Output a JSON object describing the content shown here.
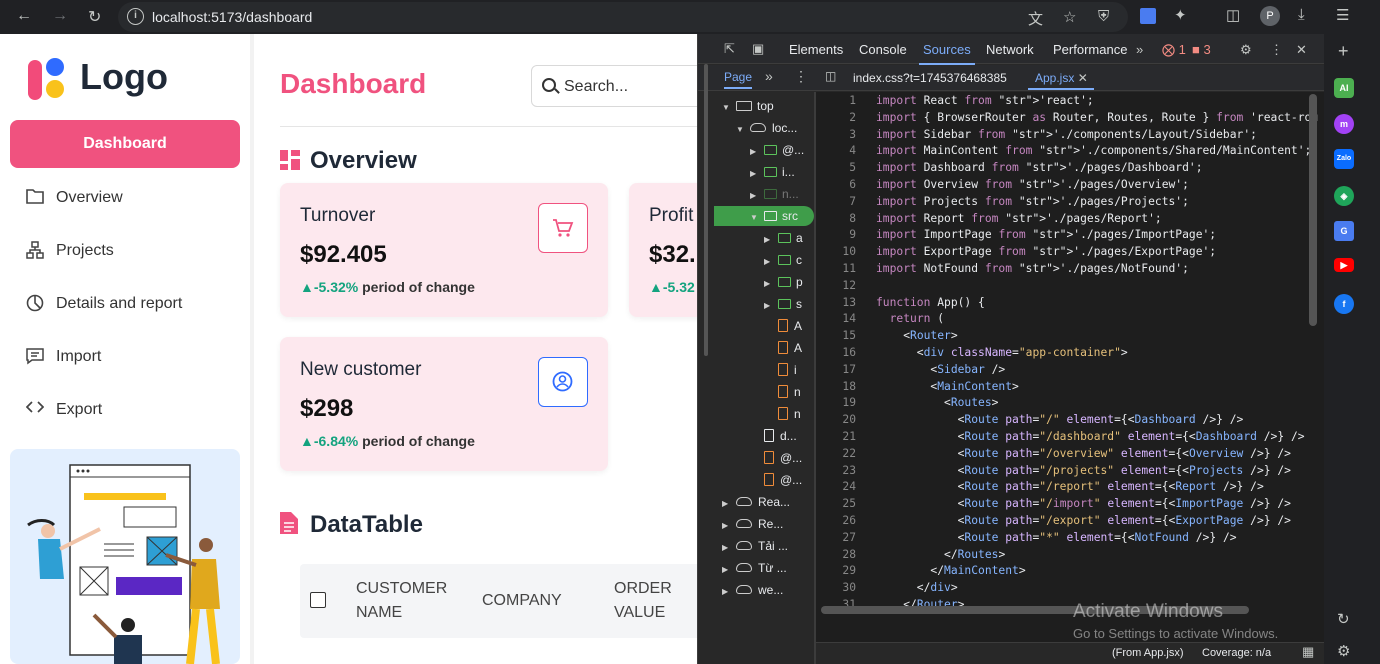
{
  "browser": {
    "url": "localhost:5173/dashboard",
    "profile_initial": "P"
  },
  "sidebar": {
    "logo_text": "Logo",
    "active_item": "Dashboard",
    "items": [
      {
        "label": "Overview",
        "icon": "folder-icon"
      },
      {
        "label": "Projects",
        "icon": "hierarchy-icon"
      },
      {
        "label": "Details and report",
        "icon": "pie-chart-icon"
      },
      {
        "label": "Import",
        "icon": "message-icon"
      },
      {
        "label": "Export",
        "icon": "code-icon"
      }
    ]
  },
  "main": {
    "title": "Dashboard",
    "search_placeholder": "Search...",
    "overview_title": "Overview",
    "cards": [
      {
        "name": "Turnover",
        "value": "$92.405",
        "change": "▲-5.32%",
        "change_label": "period of change",
        "icon": "cart-icon"
      },
      {
        "name": "Profit",
        "value": "$32.",
        "change": "▲-5.32",
        "change_label": "",
        "icon": ""
      },
      {
        "name": "New customer",
        "value": "$298",
        "change": "▲-6.84%",
        "change_label": "period of change",
        "icon": "user-icon"
      }
    ],
    "table_title": "DataTable",
    "columns": [
      "CUSTOMER NAME",
      "COMPANY",
      "ORDER VALUE"
    ]
  },
  "devtools": {
    "tabs": [
      "Elements",
      "Console",
      "Sources",
      "Network",
      "Performance"
    ],
    "active_tab": "Sources",
    "error_count": "1",
    "warning_count": "3",
    "page_tab": "Page",
    "open_files": [
      "index.css?t=1745376468385",
      "App.jsx"
    ],
    "tree": [
      "top",
      "loc...",
      "@...",
      "i...",
      "n...",
      "src",
      "a",
      "c",
      "p",
      "s",
      "A",
      "A",
      "i",
      "n",
      "n",
      "d...",
      "@...",
      "@...",
      "Rea...",
      "Re...",
      "Tải ...",
      "Từ ...",
      "we..."
    ],
    "code_lines": [
      "import React from 'react';",
      "import { BrowserRouter as Router, Routes, Route } from 'react-rou",
      "import Sidebar from './components/Layout/Sidebar';",
      "import MainContent from './components/Shared/MainContent';",
      "import Dashboard from './pages/Dashboard';",
      "import Overview from './pages/Overview';",
      "import Projects from './pages/Projects';",
      "import Report from './pages/Report';",
      "import ImportPage from './pages/ImportPage';",
      "import ExportPage from './pages/ExportPage';",
      "import NotFound from './pages/NotFound';",
      "",
      "function App() {",
      "  return (",
      "    <Router>",
      "      <div className=\"app-container\">",
      "        <Sidebar />",
      "        <MainContent>",
      "          <Routes>",
      "            <Route path=\"/\" element={<Dashboard />} />",
      "            <Route path=\"/dashboard\" element={<Dashboard />} />",
      "            <Route path=\"/overview\" element={<Overview />} />",
      "            <Route path=\"/projects\" element={<Projects />} />",
      "            <Route path=\"/report\" element={<Report />} />",
      "            <Route path=\"/import\" element={<ImportPage />} />",
      "            <Route path=\"/export\" element={<ExportPage />} />",
      "            <Route path=\"*\" element={<NotFound />} />",
      "          </Routes>",
      "        </MainContent>",
      "      </div>",
      "    </Router>"
    ],
    "status_left": "(From App.jsx)",
    "status_right": "Coverage: n/a"
  },
  "watermark": {
    "line1": "Activate Windows",
    "line2": "Go to Settings to activate Windows."
  },
  "colors": {
    "accent": "#f0527f",
    "card_bg": "#fde8ee",
    "positive": "#14a37f",
    "devtools_active": "#7cacf8"
  }
}
